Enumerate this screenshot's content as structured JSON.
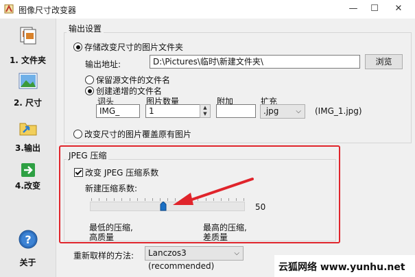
{
  "window": {
    "title": "图像尺寸改变器",
    "minimize_glyph": "—",
    "maximize_glyph": "☐",
    "close_glyph": "✕"
  },
  "sidebar": {
    "items": [
      {
        "label": "1. 文件夹",
        "icon": "folder-document-icon"
      },
      {
        "label": "2. 尺寸",
        "icon": "landscape-image-icon"
      },
      {
        "label": "3.输出",
        "icon": "output-folder-icon"
      },
      {
        "label": "4.改变",
        "icon": "green-arrow-icon"
      },
      {
        "label": "关于",
        "icon": "help-icon"
      }
    ]
  },
  "output_settings": {
    "group_title": "输出设置",
    "store_radio_label": "存储改变尺寸的图片文件夹",
    "address_label": "输出地址:",
    "address_value": "D:\\Pictures\\临时\\新建文件夹\\",
    "browse_label": "浏览",
    "keep_name_label": "保留源文件的文件名",
    "incr_name_label": "创建递增的文件名",
    "prefix_label": "词头",
    "prefix_value": "IMG_",
    "count_label": "图片数量",
    "count_value": "1",
    "suffix_label": "附加",
    "suffix_value": "",
    "ext_label": "扩充",
    "ext_value": ".jpg",
    "example_text": "(IMG_1.jpg)",
    "overwrite_label": "改变尺寸的图片覆盖原有图片"
  },
  "jpeg": {
    "group_title": "JPEG 压缩",
    "checkbox_label": "改变 JPEG 压缩系数",
    "slider_label": "新建压缩系数:",
    "slider_value": "50",
    "slider_fraction": 0.5,
    "low_label_line1": "最低的压缩,",
    "low_label_line2": "高质量",
    "high_label_line1": "最高的压缩,",
    "high_label_line2": "差质量"
  },
  "resample": {
    "label": "重新取样的方法:",
    "value": "Lanczos3 (recommended)"
  },
  "watermark": {
    "text": "云狐网络 www.yunhu.net"
  },
  "colors": {
    "annotation_red": "#e0242b",
    "slider_thumb": "#1a6fc4"
  }
}
